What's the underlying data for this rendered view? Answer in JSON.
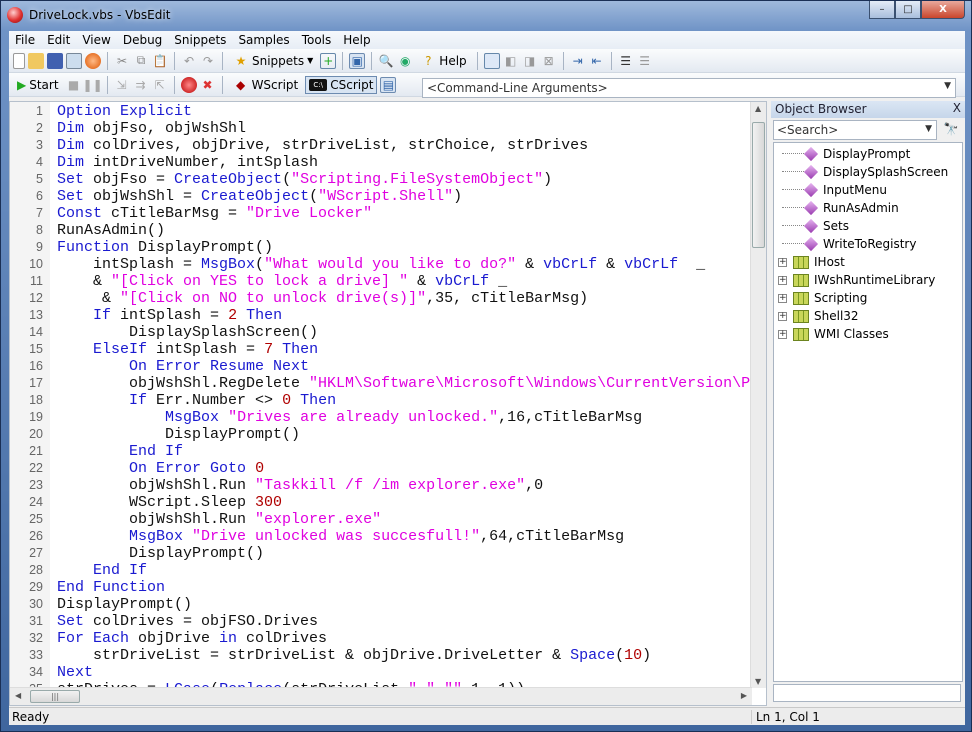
{
  "window": {
    "title": "DriveLock.vbs - VbsEdit",
    "minimize": "–",
    "maximize": "□",
    "close": "X"
  },
  "menu": [
    "File",
    "Edit",
    "View",
    "Debug",
    "Snippets",
    "Samples",
    "Tools",
    "Help"
  ],
  "toolbar": {
    "snippets_label": "Snippets",
    "help_label": "Help"
  },
  "debugbar": {
    "start_label": "Start",
    "wscript_label": "WScript",
    "cscript_label": "CScript",
    "cscript_selected": true,
    "command_line_placeholder": "<Command-Line Arguments>"
  },
  "editor": {
    "lines": [
      [
        [
          "k",
          "Option Explicit"
        ]
      ],
      [
        [
          "k",
          "Dim"
        ],
        [
          "p",
          " objFso, objWshShl"
        ]
      ],
      [
        [
          "k",
          "Dim"
        ],
        [
          "p",
          " colDrives, objDrive, strDriveList, strChoice, strDrives"
        ]
      ],
      [
        [
          "k",
          "Dim"
        ],
        [
          "p",
          " intDriveNumber, intSplash"
        ]
      ],
      [
        [
          "k",
          "Set"
        ],
        [
          "p",
          " objFso = "
        ],
        [
          "k",
          "CreateObject"
        ],
        [
          "p",
          "("
        ],
        [
          "s",
          "\"Scripting.FileSystemObject\""
        ],
        [
          "p",
          ")"
        ]
      ],
      [
        [
          "k",
          "Set"
        ],
        [
          "p",
          " objWshShl = "
        ],
        [
          "k",
          "CreateObject"
        ],
        [
          "p",
          "("
        ],
        [
          "s",
          "\"WScript.Shell\""
        ],
        [
          "p",
          ")"
        ]
      ],
      [
        [
          "k",
          "Const"
        ],
        [
          "p",
          " cTitleBarMsg = "
        ],
        [
          "s",
          "\"Drive Locker\""
        ]
      ],
      [
        [
          "p",
          "RunAsAdmin()"
        ]
      ],
      [
        [
          "k",
          "Function"
        ],
        [
          "p",
          " DisplayPrompt()"
        ]
      ],
      [
        [
          "p",
          "    intSplash = "
        ],
        [
          "k",
          "MsgBox"
        ],
        [
          "p",
          "("
        ],
        [
          "s",
          "\"What would you like to do?\""
        ],
        [
          "p",
          " & "
        ],
        [
          "k",
          "vbCrLf"
        ],
        [
          "p",
          " & "
        ],
        [
          "k",
          "vbCrLf"
        ],
        [
          "p",
          "  _"
        ]
      ],
      [
        [
          "p",
          "    & "
        ],
        [
          "s",
          "\"[Click on YES to lock a drive] \""
        ],
        [
          "p",
          " & "
        ],
        [
          "k",
          "vbCrLf"
        ],
        [
          "p",
          " _"
        ]
      ],
      [
        [
          "p",
          "     & "
        ],
        [
          "s",
          "\"[Click on NO to unlock drive(s)]\""
        ],
        [
          "p",
          ",35, cTitleBarMsg)"
        ]
      ],
      [
        [
          "p",
          "    "
        ],
        [
          "k",
          "If"
        ],
        [
          "p",
          " intSplash = "
        ],
        [
          "n",
          "2"
        ],
        [
          "p",
          " "
        ],
        [
          "k",
          "Then"
        ]
      ],
      [
        [
          "p",
          "        DisplaySplashScreen()"
        ]
      ],
      [
        [
          "p",
          "    "
        ],
        [
          "k",
          "ElseIf"
        ],
        [
          "p",
          " intSplash = "
        ],
        [
          "n",
          "7"
        ],
        [
          "p",
          " "
        ],
        [
          "k",
          "Then"
        ]
      ],
      [
        [
          "p",
          "        "
        ],
        [
          "k",
          "On Error Resume Next"
        ]
      ],
      [
        [
          "p",
          "        objWshShl.RegDelete "
        ],
        [
          "s",
          "\"HKLM\\Software\\Microsoft\\Windows\\CurrentVersion\\P"
        ]
      ],
      [
        [
          "p",
          "        "
        ],
        [
          "k",
          "If"
        ],
        [
          "p",
          " Err.Number <> "
        ],
        [
          "n",
          "0"
        ],
        [
          "p",
          " "
        ],
        [
          "k",
          "Then"
        ]
      ],
      [
        [
          "p",
          "            "
        ],
        [
          "k",
          "MsgBox"
        ],
        [
          "p",
          " "
        ],
        [
          "s",
          "\"Drives are already unlocked.\""
        ],
        [
          "p",
          ",16,cTitleBarMsg"
        ]
      ],
      [
        [
          "p",
          "            DisplayPrompt()"
        ]
      ],
      [
        [
          "p",
          "        "
        ],
        [
          "k",
          "End If"
        ]
      ],
      [
        [
          "p",
          "        "
        ],
        [
          "k",
          "On Error Goto"
        ],
        [
          "p",
          " "
        ],
        [
          "n",
          "0"
        ]
      ],
      [
        [
          "p",
          "        objWshShl.Run "
        ],
        [
          "s",
          "\"Taskkill /f /im explorer.exe\""
        ],
        [
          "p",
          ",0"
        ]
      ],
      [
        [
          "p",
          "        WScript.Sleep "
        ],
        [
          "n",
          "300"
        ]
      ],
      [
        [
          "p",
          "        objWshShl.Run "
        ],
        [
          "s",
          "\"explorer.exe\""
        ]
      ],
      [
        [
          "p",
          "        "
        ],
        [
          "k",
          "MsgBox"
        ],
        [
          "p",
          " "
        ],
        [
          "s",
          "\"Drive unlocked was succesfull!\""
        ],
        [
          "p",
          ",64,cTitleBarMsg"
        ]
      ],
      [
        [
          "p",
          "        DisplayPrompt()"
        ]
      ],
      [
        [
          "p",
          "    "
        ],
        [
          "k",
          "End If"
        ]
      ],
      [
        [
          "k",
          "End Function"
        ]
      ],
      [
        [
          "p",
          "DisplayPrompt()"
        ]
      ],
      [
        [
          "k",
          "Set"
        ],
        [
          "p",
          " colDrives = objFSO.Drives"
        ]
      ],
      [
        [
          "k",
          "For Each"
        ],
        [
          "p",
          " objDrive "
        ],
        [
          "k",
          "in"
        ],
        [
          "p",
          " colDrives"
        ]
      ],
      [
        [
          "p",
          "    strDriveList = strDriveList & objDrive.DriveLetter & "
        ],
        [
          "k",
          "Space"
        ],
        [
          "p",
          "("
        ],
        [
          "n",
          "10"
        ],
        [
          "p",
          ")"
        ]
      ],
      [
        [
          "k",
          "Next"
        ]
      ],
      [
        [
          "p",
          "strDrives = "
        ],
        [
          "k",
          "LCase"
        ],
        [
          "p",
          "("
        ],
        [
          "k",
          "Replace"
        ],
        [
          "p",
          "(strDriveList,"
        ],
        [
          "s",
          "\" \""
        ],
        [
          "p",
          ","
        ],
        [
          "s",
          "\"\""
        ],
        [
          "p",
          ",1,-1))"
        ]
      ]
    ]
  },
  "object_browser": {
    "title": "Object Browser",
    "close": "X",
    "search_placeholder": "<Search>",
    "methods": [
      "DisplayPrompt",
      "DisplaySplashScreen",
      "InputMenu",
      "RunAsAdmin",
      "Sets",
      "WriteToRegistry"
    ],
    "libraries": [
      "IHost",
      "IWshRuntimeLibrary",
      "Scripting",
      "Shell32",
      "WMI Classes"
    ]
  },
  "status": {
    "text": "Ready",
    "position": "Ln 1, Col 1"
  },
  "colors": {
    "keyword": "#1a1ad0",
    "string": "#e000e0",
    "number": "#b00000"
  }
}
